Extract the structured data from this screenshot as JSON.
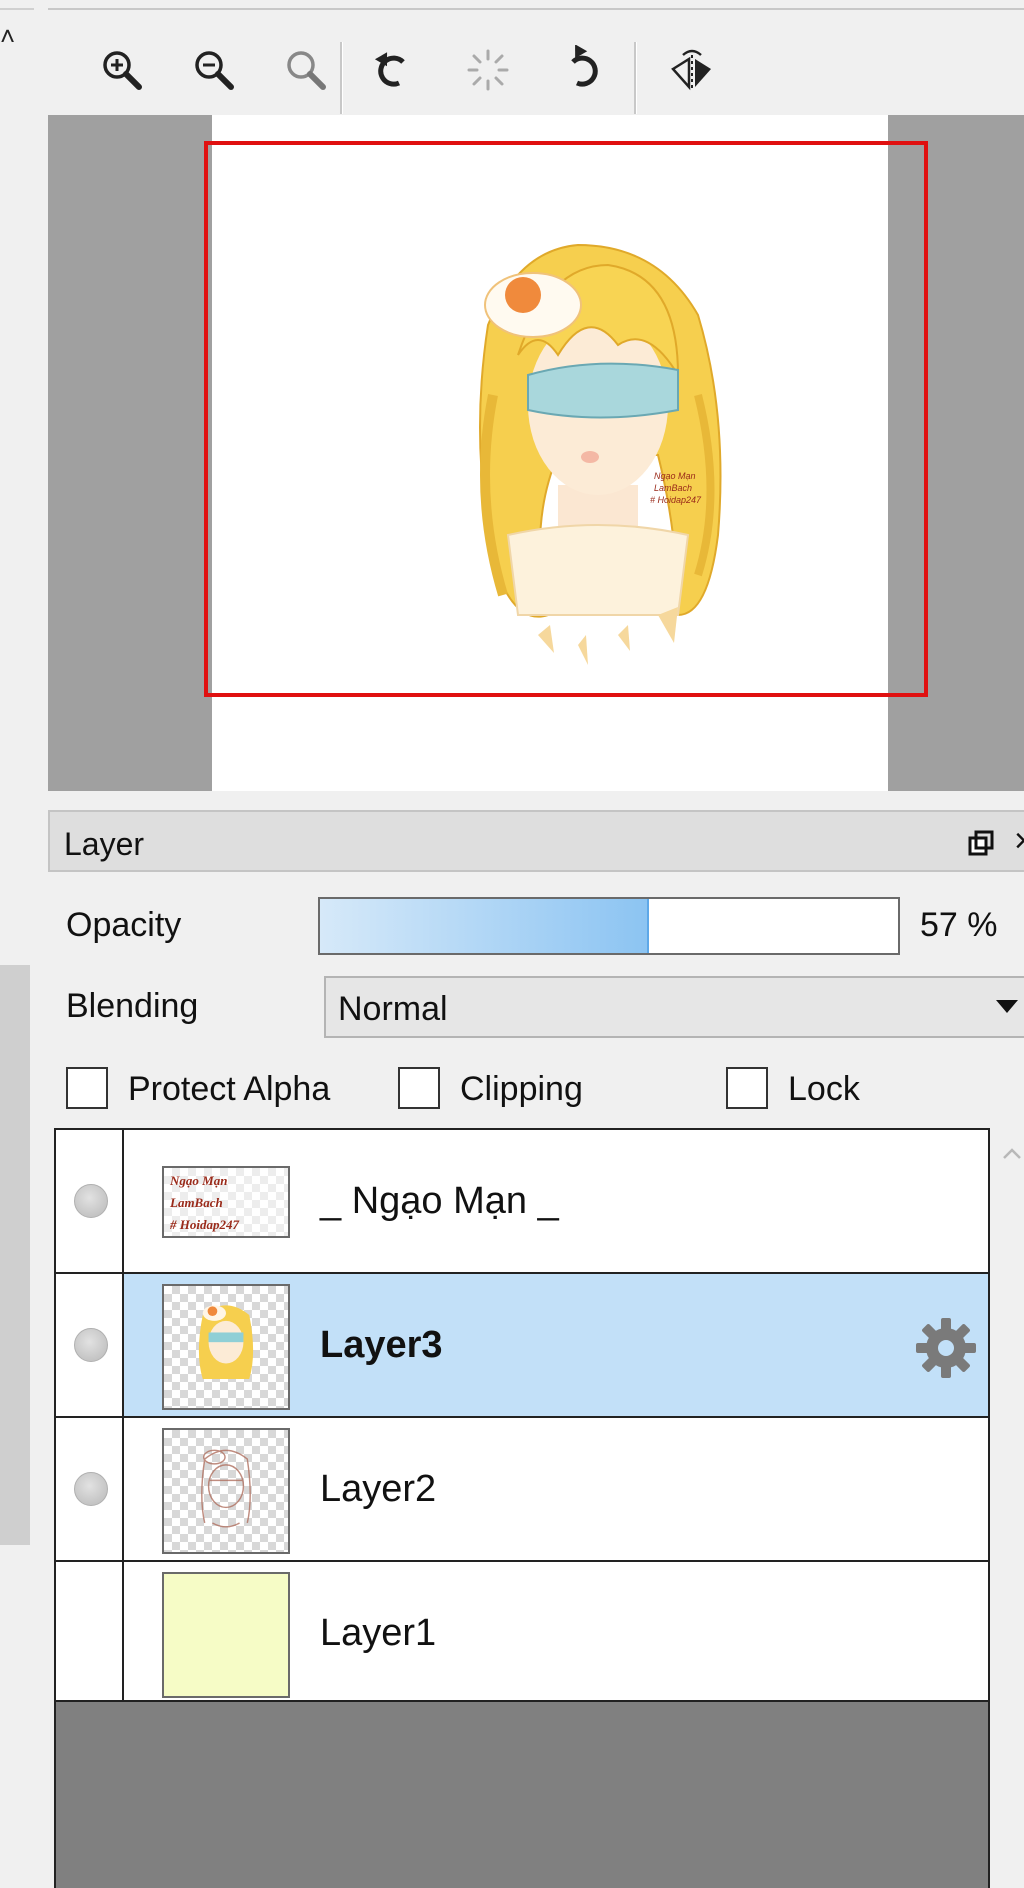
{
  "toolbar": {
    "tools": [
      {
        "name": "zoom-in-icon"
      },
      {
        "name": "zoom-out-icon"
      },
      {
        "name": "zoom-reset-icon"
      },
      {
        "name": "rotate-left-icon"
      },
      {
        "name": "rotate-reset-icon"
      },
      {
        "name": "rotate-right-icon"
      },
      {
        "name": "flip-horizontal-icon"
      }
    ]
  },
  "navigator": {
    "artwork_watermark": [
      "Ngạo Mạn",
      "LamBach",
      "# Hoidap247"
    ],
    "viewport_color": "#e01010"
  },
  "layer_panel": {
    "title": "Layer",
    "opacity": {
      "label": "Opacity",
      "value_text": "57 %",
      "value": 57
    },
    "blending": {
      "label": "Blending",
      "selected": "Normal"
    },
    "checkboxes": [
      {
        "label": "Protect Alpha",
        "checked": false
      },
      {
        "label": "Clipping",
        "checked": false
      },
      {
        "label": "Lock",
        "checked": false
      }
    ],
    "layers": [
      {
        "name": "_ Ngạo Mạn _",
        "visible": true,
        "selected": false,
        "thumb_text": [
          "Ngạo Mạn",
          "LamBach",
          "# Hoidap247"
        ]
      },
      {
        "name": "Layer3",
        "visible": true,
        "selected": true
      },
      {
        "name": "Layer2",
        "visible": true,
        "selected": false
      },
      {
        "name": "Layer1",
        "visible": false,
        "selected": false
      }
    ],
    "selected_color": "#c2e0f8"
  }
}
